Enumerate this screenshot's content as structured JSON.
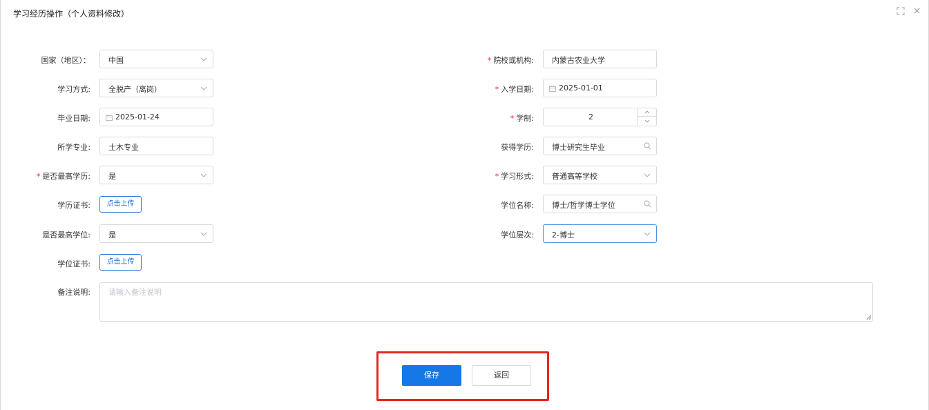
{
  "dialog": {
    "title": "学习经历操作（个人资料修改）",
    "maximize_icon": "expand-icon",
    "close_icon": "close-icon"
  },
  "form": {
    "country": {
      "label": "国家（地区）：",
      "value": "中国"
    },
    "institution": {
      "label": "院校或机构:",
      "value": "内蒙古农业大学",
      "required": true
    },
    "study_mode": {
      "label": "学习方式:",
      "value": "全脱产（离岗）"
    },
    "enroll_date": {
      "label": "入学日期:",
      "value": "2025-01-01",
      "required": true
    },
    "graduation_date": {
      "label": "毕业日期:",
      "value": "2025-01-24"
    },
    "duration": {
      "label": "学制:",
      "value": "2",
      "required": true
    },
    "major": {
      "label": "所学专业:",
      "value": "土木专业"
    },
    "education_obtained": {
      "label": "获得学历:",
      "value": "博士研究生毕业"
    },
    "highest_education": {
      "label": "是否最高学历:",
      "value": "是",
      "required": true
    },
    "study_form": {
      "label": "学习形式:",
      "value": "普通高等学校",
      "required": true
    },
    "education_certificate": {
      "label": "学历证书:",
      "button": "点击上传"
    },
    "degree_name": {
      "label": "学位名称:",
      "value": "博士/哲学博士学位"
    },
    "highest_degree": {
      "label": "是否最高学位:",
      "value": "是"
    },
    "degree_level": {
      "label": "学位层次:",
      "value": "2-博士"
    },
    "degree_certificate": {
      "label": "学位证书:",
      "button": "点击上传"
    },
    "remarks": {
      "label": "备注说明:",
      "placeholder": "请输入备注说明"
    }
  },
  "actions": {
    "save": "保存",
    "back": "返回"
  },
  "colors": {
    "primary": "#1677e6",
    "required": "#f5222d",
    "highlight": "#e8261f"
  }
}
